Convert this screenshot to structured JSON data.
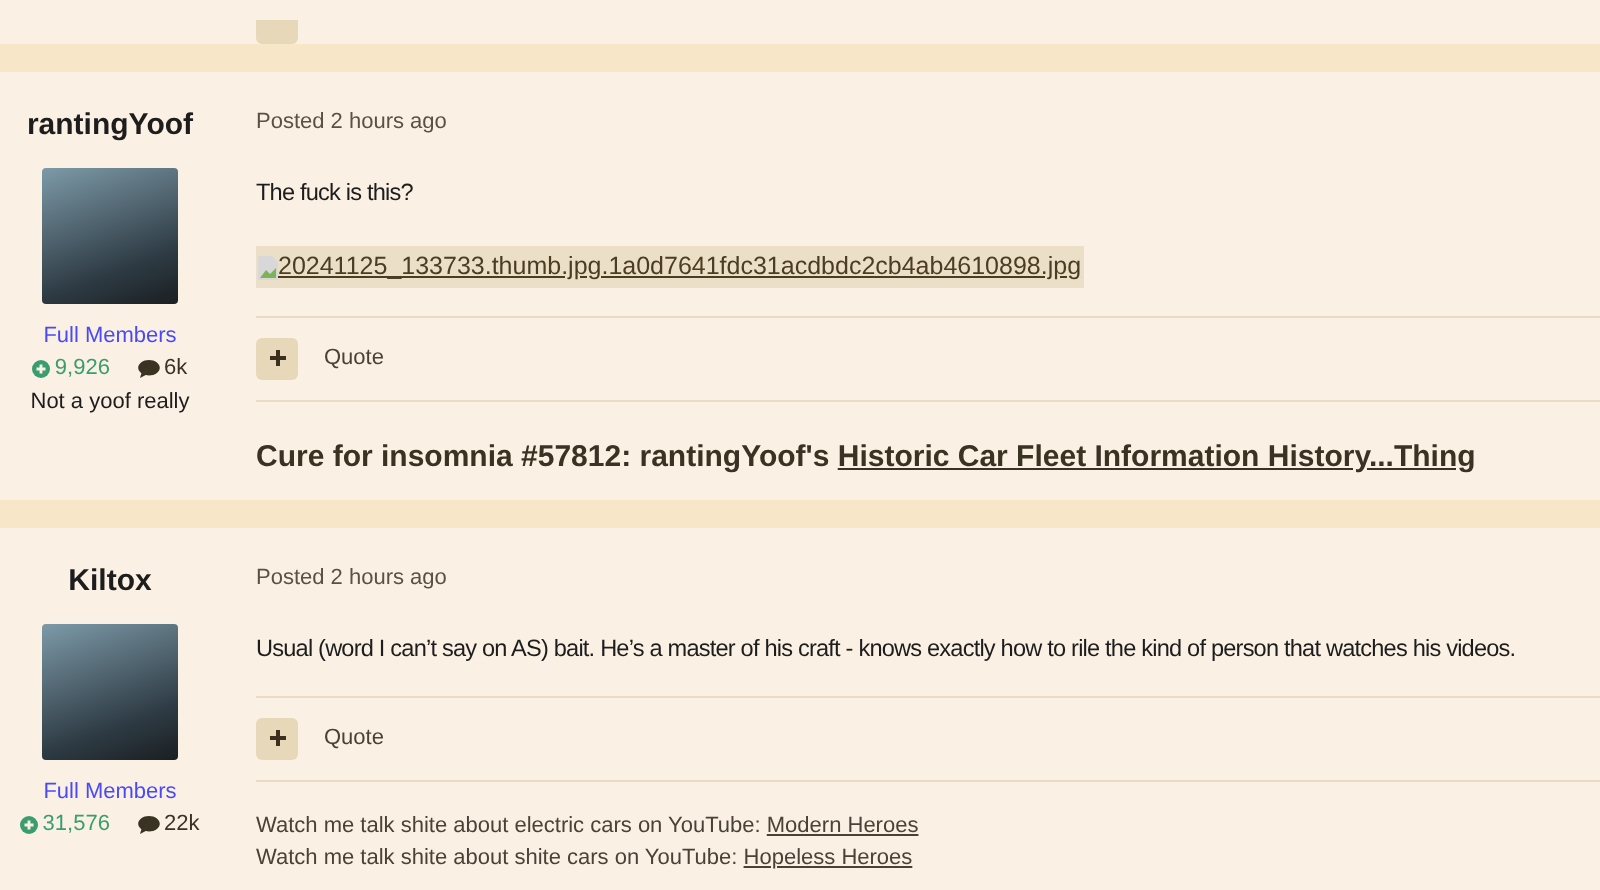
{
  "posts": [
    {
      "author": "rantingYoof",
      "group": "Full Members",
      "reputation": "9,926",
      "post_count": "6k",
      "member_title": "Not a yoof really",
      "posted": "Posted 2 hours ago",
      "body": [
        {
          "kind": "text",
          "text": "The fuck is this?"
        },
        {
          "kind": "image_link",
          "text": "20241125_133733.thumb.jpg.1a0d7641fdc31acdbdc2cb4ab4610898.jpg"
        }
      ],
      "quote_label": "Quote",
      "signature": [
        {
          "kind": "large",
          "text": "Cure for insomnia #57812: rantingYoof's",
          "link": "Historic Car Fleet Information History...Thing"
        }
      ]
    },
    {
      "author": "Kiltox",
      "group": "Full Members",
      "reputation": "31,576",
      "post_count": "22k",
      "posted": "Posted 2 hours ago",
      "body": [
        {
          "kind": "text",
          "text": "Usual (word I can’t say on AS) bait. He’s a master of his craft - knows exactly how to rile the kind of person that watches his videos."
        }
      ],
      "quote_label": "Quote",
      "signature": [
        {
          "kind": "small",
          "text": "Watch me talk shite about electric cars on YouTube:",
          "link": "Modern Heroes"
        },
        {
          "kind": "small",
          "text": "Watch me talk shite about shite cars on YouTube:",
          "link": "Hopeless Heroes"
        }
      ]
    }
  ]
}
